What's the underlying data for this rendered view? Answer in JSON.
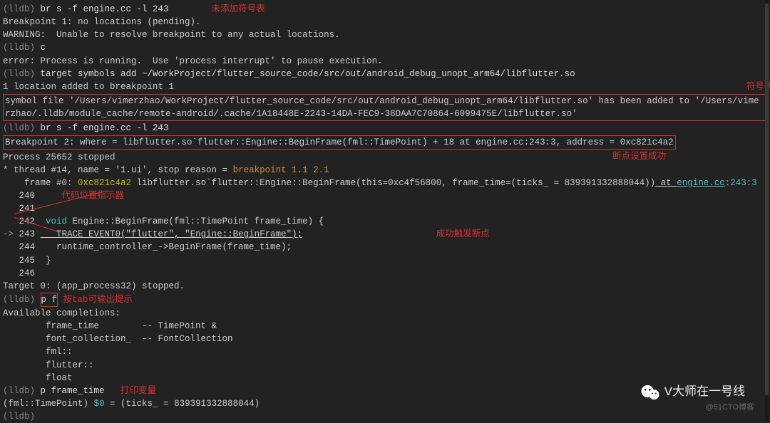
{
  "lines": {
    "l1_prompt": "(lldb) ",
    "l1_cmd": "br s -f engine.cc -l 243",
    "ann1": "未添加符号表",
    "l2": "Breakpoint 1: no locations (pending).",
    "l3": "WARNING:  Unable to resolve breakpoint to any actual locations.",
    "l4_prompt": "(lldb) ",
    "l4_cmd": "c",
    "l5": "error: Process is running.  Use 'process interrupt' to pause execution.",
    "l6_prompt": "(lldb) ",
    "l6_cmd": "target symbols add ~/WorkProject/flutter_source_code/src/out/android_debug_unopt_arm64/libflutter.so",
    "l7": "1 location added to breakpoint 1",
    "ann2": "符号表添加成功",
    "l8a": "symbol file '/Users/vimerzhao/WorkProject/flutter_source_code/src/out/android_debug_unopt_arm64/libflutter.so' has been added to '/Users/vime",
    "l8b": "rzhao/.lldb/module_cache/remote-android/.cache/1A18448E-2243-14DA-FEC9-38DAA7C70864-6099475E/libflutter.so'",
    "l9_prompt": "(lldb) ",
    "l9_cmd": "br s -f engine.cc -l 243",
    "l10": "Breakpoint 2: where = libflutter.so`flutter::Engine::BeginFrame(fml::TimePoint) + 18 at engine.cc:243:3, address = 0xc821c4a2",
    "ann3": "断点设置成功",
    "l11": "Process 25652 stopped",
    "l12a": "* thread #14, name = '1.ui', stop reason = ",
    "l12b": "breakpoint 1.1 2.1",
    "l13a": "    frame #0: ",
    "l13_addr": "0xc821c4a2",
    "l13b": " libflutter.so`flutter::Engine::BeginFrame(this=0xc4f56800, frame_time=(ticks_ = 839391332888044))",
    "l13_at": " at ",
    "l13_file": "engine.cc",
    "l13_loc": ":243:3",
    "ln240": "   240 ",
    "ann4": "代码位置指示器",
    "ln241": "   241 ",
    "ln242_num": "   242  ",
    "ln242_void": "void",
    "ln242_rest": " Engine::BeginFrame(fml::TimePoint frame_time) {",
    "ln243_marker": "-> ",
    "ln243_num": "243 ",
    "ln243_code": "   TRACE_EVENT0(\"flutter\", \"Engine::BeginFrame\");",
    "ann5": "成功触发断点",
    "ln244": "   244    runtime_controller_->BeginFrame(frame_time);",
    "ln245": "   245  }",
    "ln246": "   246 ",
    "l_target": "Target 0: (app_process32) stopped.",
    "lpf_prompt": "(lldb) ",
    "lpf_cmd": "p f",
    "ann6": "按tab可输出提示",
    "l_avail": "Available completions:",
    "comp1": "        frame_time        -- TimePoint &",
    "comp2": "        font_collection_  -- FontCollection",
    "comp3": "        fml::",
    "comp4": "        flutter::",
    "comp5": "        float",
    "lp_prompt": "(lldb) ",
    "lp_cmd": "p frame_time",
    "ann7": "打印变量",
    "lres_a": "(fml::TimePoint) ",
    "lres_b": "$0",
    "lres_c": " = (ticks_ = 839391332888044)",
    "lend": "(lldb) "
  },
  "watermark": {
    "main": "V大师在一号线",
    "sub": "@51CTO博客"
  }
}
